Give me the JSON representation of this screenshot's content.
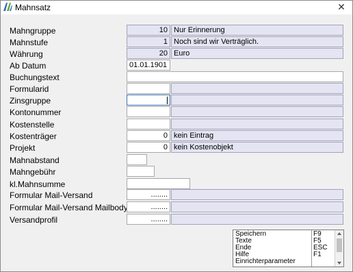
{
  "window": {
    "title": "Mahnsatz",
    "close_glyph": "✕",
    "icon": "app-logo-icon"
  },
  "labels": {
    "mahngruppe": "Mahngruppe",
    "mahnstufe": "Mahnstufe",
    "waehrung": "Währung",
    "ab_datum": "Ab Datum",
    "buchungstext": "Buchungstext",
    "formularid": "Formularid",
    "zinsgruppe": "Zinsgruppe",
    "kontonummer": "Kontonummer",
    "kostenstelle": "Kostenstelle",
    "kostentraeger": "Kostenträger",
    "projekt": "Projekt",
    "mahnabstand": "Mahnabstand",
    "mahngebuehr": "Mahngebühr",
    "kl_mahnsumme": "kl.Mahnsumme",
    "formular_mail": "Formular Mail-Versand",
    "formular_mail_body": "Formular Mail-Versand Mailbody",
    "versandprofil": "Versandprofil"
  },
  "fields": {
    "mahngruppe_value": "10",
    "mahngruppe_desc": "Nur Erinnerung",
    "mahnstufe_value": "1",
    "mahnstufe_desc": "Noch sind wir Verträglich.",
    "waehrung_value": "20",
    "waehrung_desc": "Euro",
    "ab_datum_value": "01.01.1901",
    "kostentraeger_value": "0",
    "kostentraeger_desc": "kein Eintrag",
    "projekt_value": "0",
    "projekt_desc": "kein Kostenobjekt",
    "formular_mail_value": "........",
    "formular_mail_body_value": "........",
    "versandprofil_value": "........"
  },
  "commands": [
    {
      "name": "Speichern",
      "key": "F9"
    },
    {
      "name": "Texte",
      "key": "F5"
    },
    {
      "name": "Ende",
      "key": "ESC"
    },
    {
      "name": "Hilfe",
      "key": "F1"
    },
    {
      "name": "Einrichterparameter",
      "key": ""
    }
  ],
  "colors": {
    "readonly_bg": "#e4e4f3",
    "focus_border": "#3a6fb0"
  }
}
